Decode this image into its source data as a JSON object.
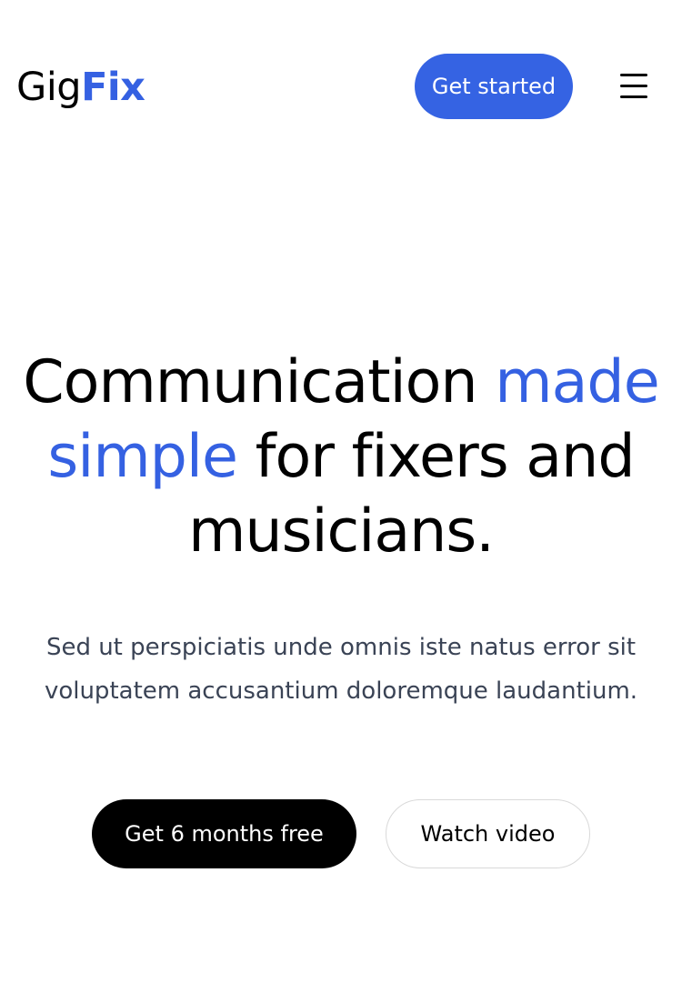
{
  "header": {
    "logo_part1": "Gig",
    "logo_part2": "Fix",
    "cta_label": "Get started",
    "menu_icon": "hamburger-menu-icon"
  },
  "hero": {
    "title_part1": "Communication ",
    "title_accent": "made simple",
    "title_part2": " for fixers and musicians.",
    "subtitle": "Sed ut perspiciatis unde omnis iste natus error sit voluptatem accusantium doloremque laudantium.",
    "primary_button": "Get 6 months free",
    "secondary_button": "Watch video"
  },
  "colors": {
    "accent": "#3563e3",
    "text": "#000000",
    "subtext": "#3a4355"
  }
}
